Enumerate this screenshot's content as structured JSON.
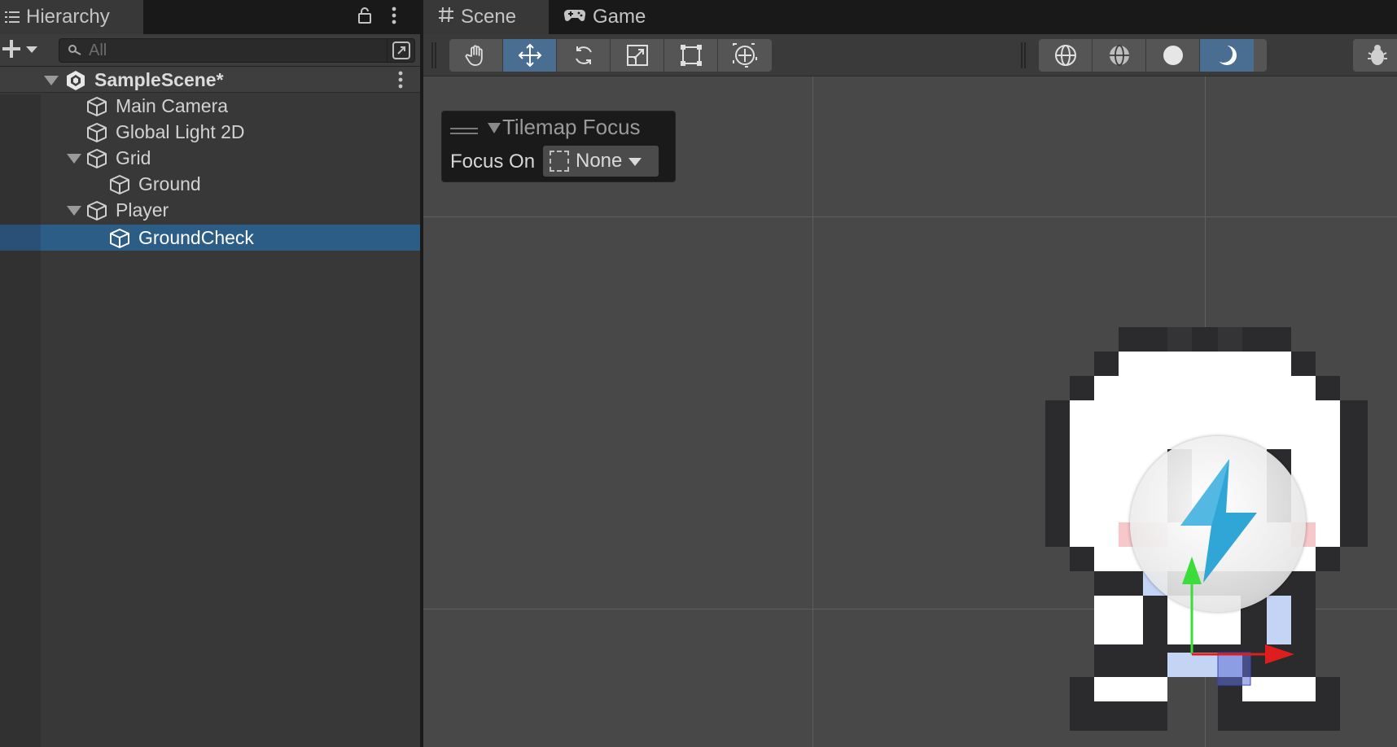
{
  "hierarchy": {
    "tab_label": "Hierarchy",
    "search": {
      "placeholder": "All",
      "value": ""
    },
    "scene_name": "SampleScene*",
    "items": [
      {
        "label": "Main Camera"
      },
      {
        "label": "Global Light 2D"
      },
      {
        "label": "Grid"
      },
      {
        "label": "Ground"
      },
      {
        "label": "Player"
      },
      {
        "label": "GroundCheck"
      }
    ],
    "selected_item": "GroundCheck"
  },
  "scene_view": {
    "tabs": [
      {
        "label": "Scene",
        "active": true
      },
      {
        "label": "Game",
        "active": false
      }
    ],
    "tools": [
      "hand-tool",
      "move-tool",
      "rotate-tool",
      "scale-tool",
      "rect-tool",
      "transform-tool"
    ],
    "active_tool": "move-tool",
    "view_modes": [
      "wireframe",
      "shaded-wireframe",
      "shaded",
      "lighting"
    ],
    "active_view_mode": "lighting",
    "overlay": {
      "title": "Tilemap Focus",
      "focus_label": "Focus On",
      "focus_value": "None"
    }
  },
  "colors": {
    "selection": "#2c5d87",
    "active_tool": "#4a6d92",
    "gizmo_x": "#e01d1d",
    "gizmo_y": "#3cdc3c",
    "bolt": "#2fa6d6"
  }
}
